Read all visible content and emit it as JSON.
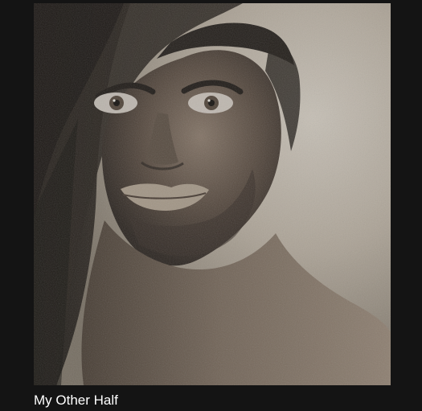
{
  "artwork": {
    "title": "My Other Half",
    "description_icon": "portrait-artwork"
  },
  "theme": {
    "background": "#141414",
    "caption_color": "#ffffff",
    "sepia_light": "#d5cdc2",
    "sepia_mid": "#8e8376",
    "sepia_dark": "#2a241f"
  }
}
